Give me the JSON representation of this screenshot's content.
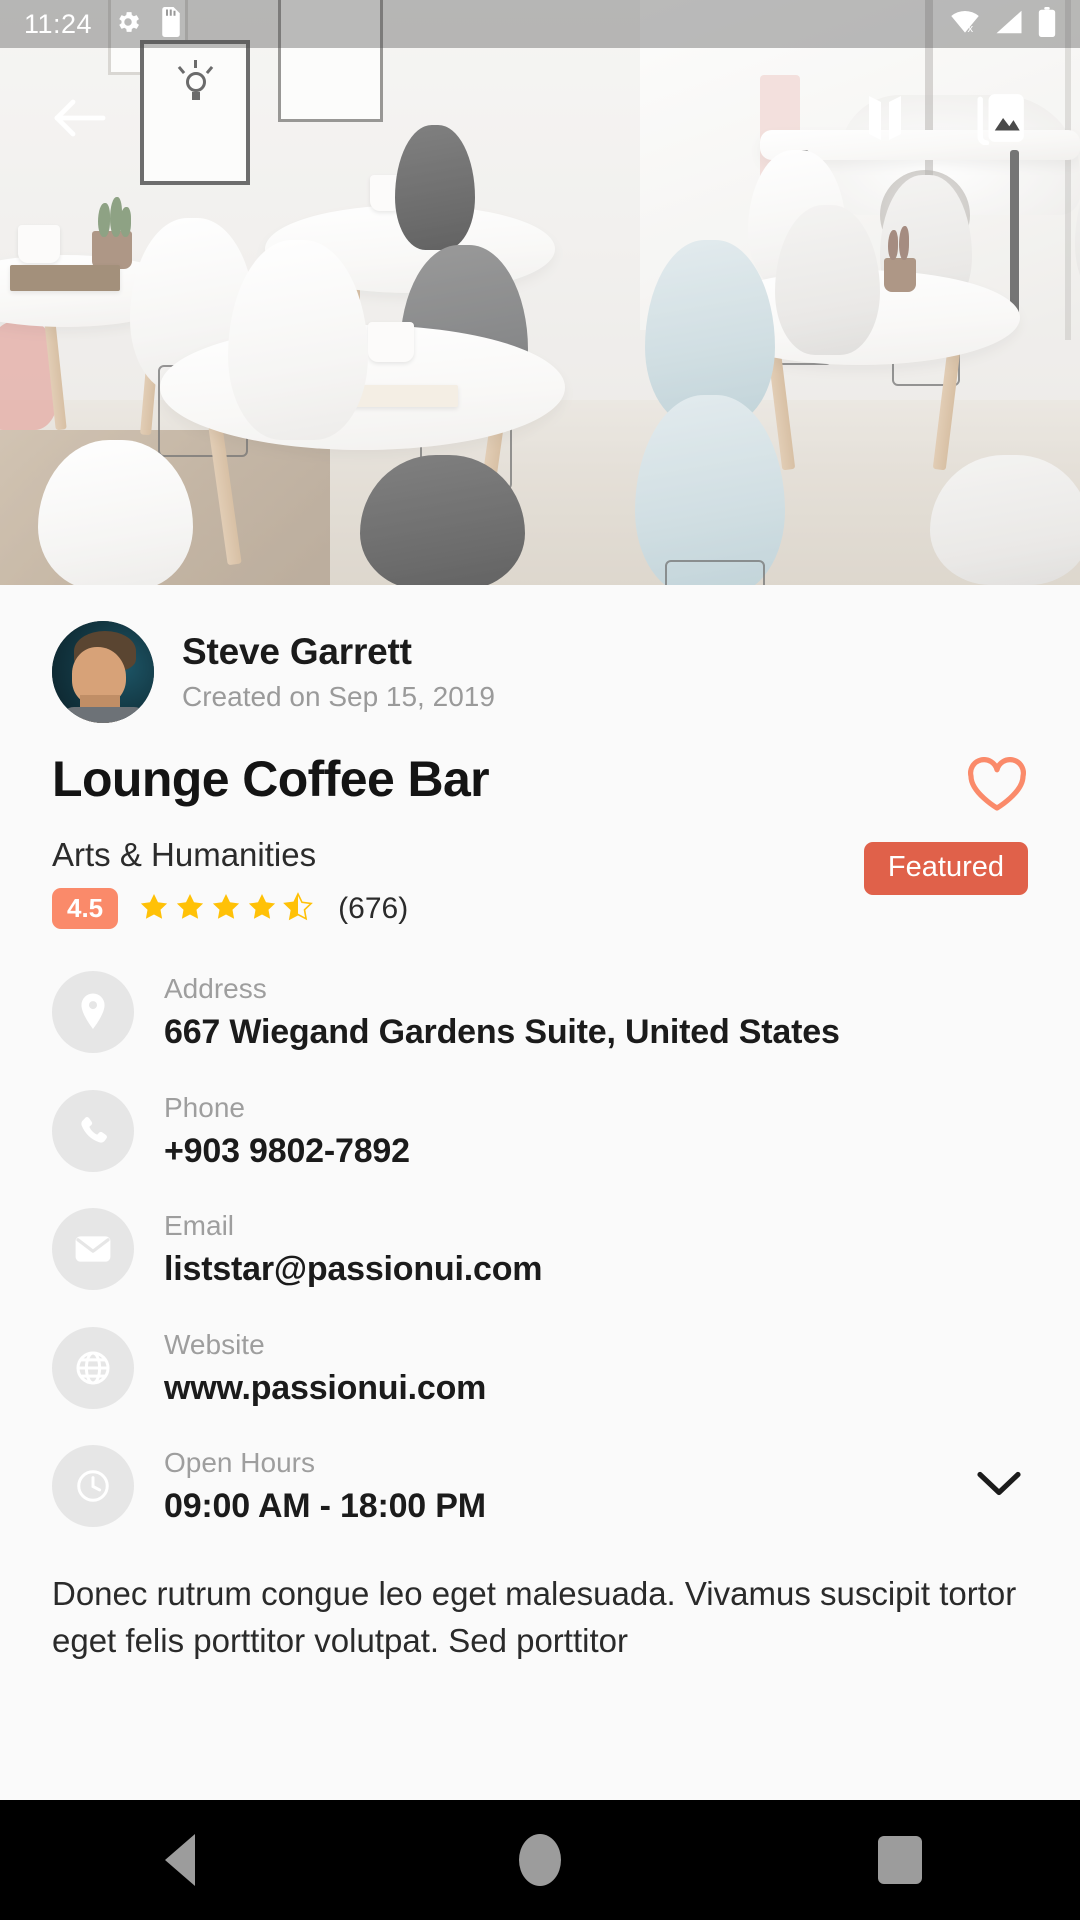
{
  "status_bar": {
    "time": "11:24",
    "left_icons": [
      "settings-gear-icon",
      "sd-card-icon"
    ],
    "right_icons": [
      "wifi-off-icon",
      "cellular-signal-icon",
      "battery-full-icon"
    ]
  },
  "hero": {
    "image_description": "Bright cafe interior with white round tables and molded chairs",
    "back_button": "back-arrow-icon",
    "map_button": "map-icon",
    "gallery_button": "gallery-icon"
  },
  "author": {
    "name": "Steve Garrett",
    "created": "Created on Sep 15, 2019"
  },
  "listing": {
    "title": "Lounge Coffee Bar",
    "category": "Arts & Humanities",
    "rating_value": "4.5",
    "stars_filled": 4,
    "stars_half": 1,
    "stars_total": 5,
    "review_count": "(676)",
    "featured_label": "Featured",
    "favorite_icon": "heart-outline-icon",
    "accent_rating": "#FA8A6A",
    "accent_featured": "#E0614A",
    "accent_star": "#FFC107"
  },
  "info_rows": [
    {
      "icon": "location-pin-icon",
      "label": "Address",
      "value": "667 Wiegand Gardens Suite, United States"
    },
    {
      "icon": "phone-icon",
      "label": "Phone",
      "value": "+903 9802-7892"
    },
    {
      "icon": "envelope-icon",
      "label": "Email",
      "value": "liststar@passionui.com"
    },
    {
      "icon": "globe-icon",
      "label": "Website",
      "value": "www.passionui.com"
    },
    {
      "icon": "clock-icon",
      "label": "Open Hours",
      "value": "09:00 AM - 18:00 PM",
      "expandable": true
    }
  ],
  "description": "Donec rutrum congue leo eget malesuada. Vivamus suscipit tortor eget felis porttitor volutpat. Sed porttitor",
  "nav_bar": {
    "back": "nav-back-icon",
    "home": "nav-home-icon",
    "recents": "nav-recents-icon"
  }
}
